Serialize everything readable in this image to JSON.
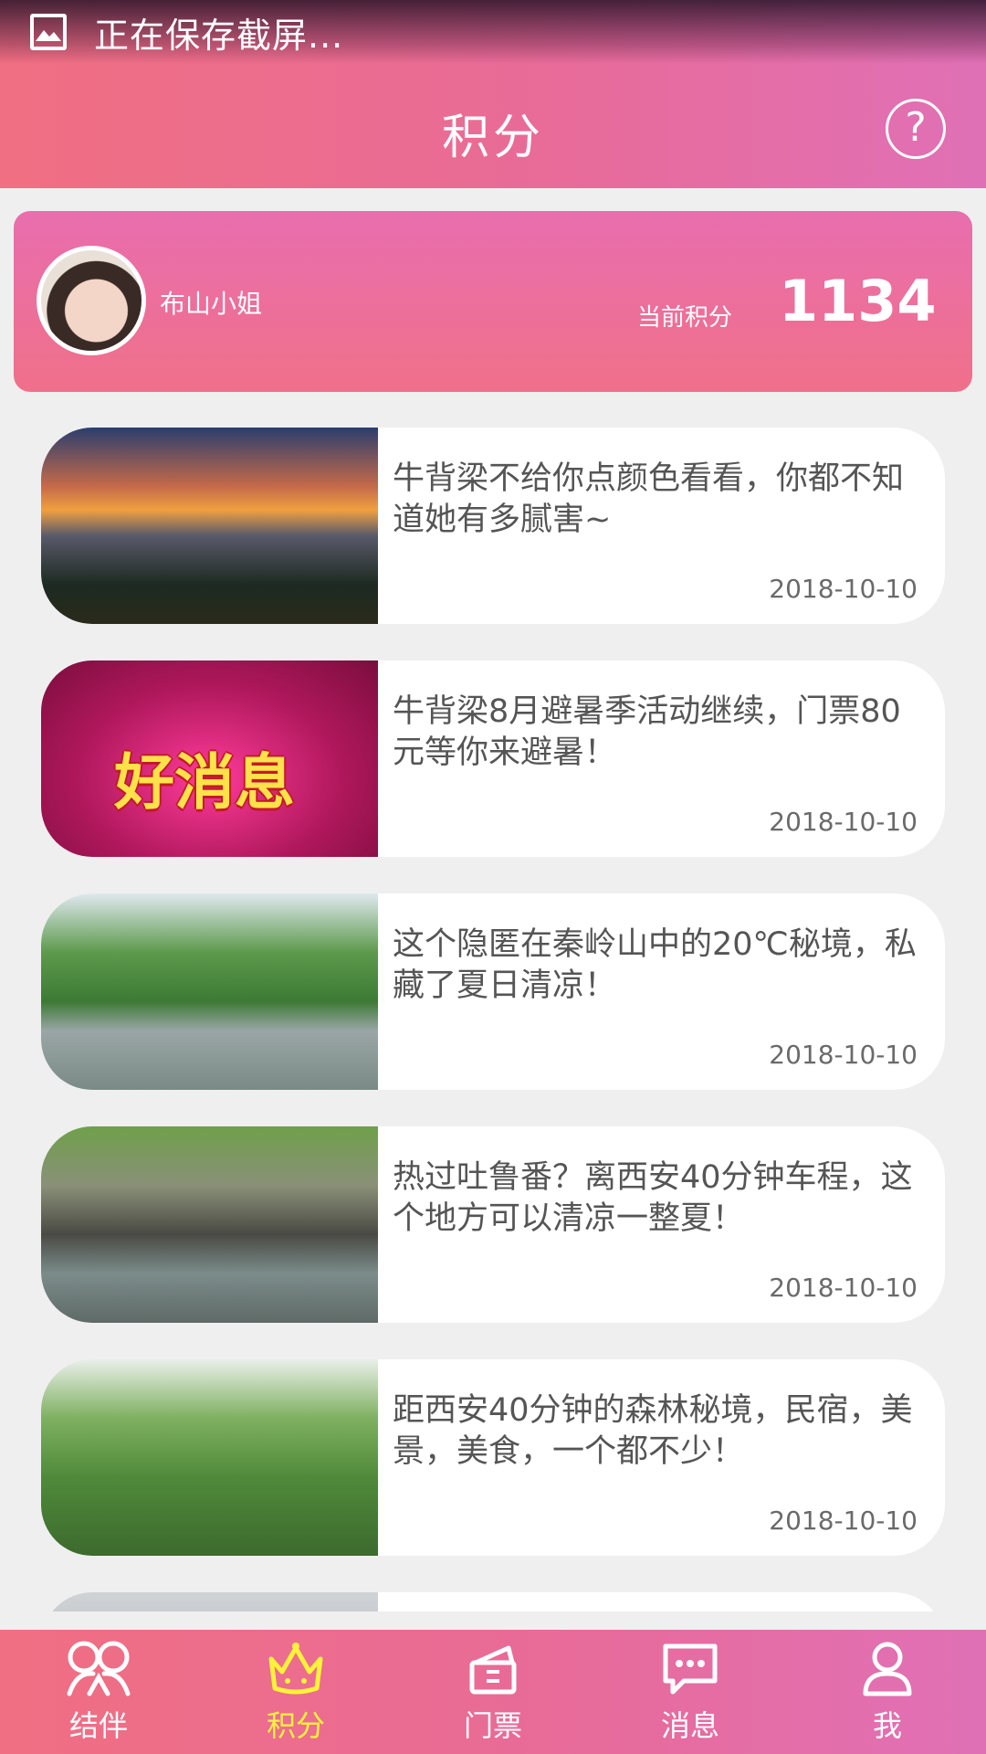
{
  "status_bar": {
    "text": "正在保存截屏..."
  },
  "header": {
    "title": "积分",
    "help_icon": "help-circle-icon"
  },
  "profile": {
    "username": "布山小姐",
    "points_label": "当前积分",
    "points_value": "1134"
  },
  "articles": [
    {
      "title": "牛背梁不给你点颜色看看，你都不知道她有多腻害~",
      "date": "2018-10-10"
    },
    {
      "title": "牛背梁8月避暑季活动继续，门票80元等你来避暑！",
      "date": "2018-10-10",
      "image_text": "好消息"
    },
    {
      "title": "这个隐匿在秦岭山中的20℃秘境，私藏了夏日清凉！",
      "date": "2018-10-10"
    },
    {
      "title": "热过吐鲁番？离西安40分钟车程，这个地方可以清凉一整夏！",
      "date": "2018-10-10"
    },
    {
      "title": "距西安40分钟的森林秘境，民宿，美景，美食，一个都不少！",
      "date": "2018-10-10"
    }
  ],
  "nav": {
    "items": [
      {
        "label": "结伴",
        "icon": "companions-icon"
      },
      {
        "label": "积分",
        "icon": "crown-icon",
        "active": true
      },
      {
        "label": "门票",
        "icon": "ticket-icon"
      },
      {
        "label": "消息",
        "icon": "message-icon"
      },
      {
        "label": "我",
        "icon": "user-icon"
      }
    ]
  },
  "colors": {
    "header_gradient": [
      "#f06f82",
      "#e070b6"
    ],
    "active_nav": "#fff33a",
    "background": "#efefef"
  }
}
